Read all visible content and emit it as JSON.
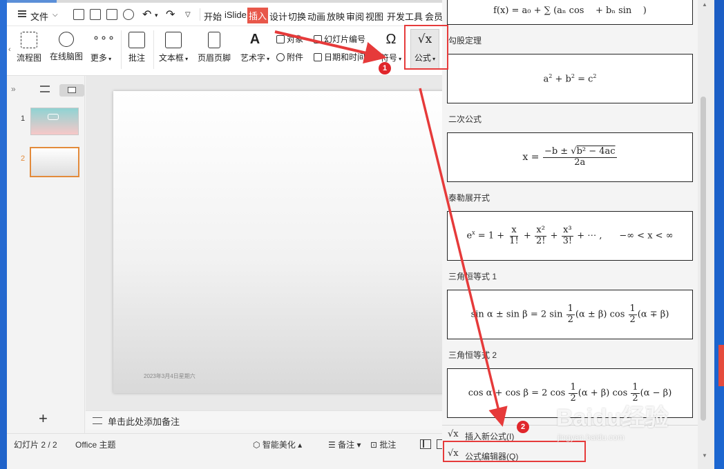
{
  "menu": {
    "file": "文件",
    "tabs": [
      "开始",
      "iSlide",
      "插入",
      "设计",
      "切换",
      "动画",
      "放映",
      "审阅",
      "视图",
      "开发工具",
      "会员"
    ],
    "active_tab": "插入"
  },
  "ribbon": {
    "flowchart": "流程图",
    "mindmap": "在线脑图",
    "more": "更多",
    "comment": "批注",
    "textbox": "文本框",
    "header_footer": "页眉页脚",
    "wordart": "艺术字",
    "object": "对象",
    "attachment": "附件",
    "slide_number": "幻灯片编号",
    "datetime": "日期和时间",
    "symbol": "符号",
    "formula": "公式"
  },
  "thumbs": [
    {
      "num": "1"
    },
    {
      "num": "2"
    }
  ],
  "slide": {
    "date": "2023年3月4日星期六"
  },
  "notes_placeholder": "单击此处添加备注",
  "status": {
    "slide_info": "幻灯片 2 / 2",
    "theme": "Office 主题",
    "beautify": "智能美化",
    "notes": "备注",
    "comment": "批注"
  },
  "formula_panel": {
    "sections": [
      {
        "label": "勾股定理",
        "formula": "a² + b² = c²"
      },
      {
        "label": "二次公式",
        "formula": "x = (−b ± √(b² − 4ac)) / 2a"
      },
      {
        "label": "泰勒展开式",
        "formula": "eˣ = 1 + x/1! + x²/2! + x³/3! + ⋯ ,  −∞ < x < ∞"
      },
      {
        "label": "三角恒等式 1",
        "formula": "sin α ± sin β = 2 sin ½(α ± β) cos ½(α ∓ β)"
      },
      {
        "label": "三角恒等式 2",
        "formula": "cos α + cos β = 2 cos ½(α + β) cos ½(α − β)"
      }
    ],
    "insert_new": "插入新公式(I)",
    "editor": "公式编辑器(Q)"
  },
  "annotations": {
    "badge1": "1",
    "badge2": "2"
  },
  "watermark": {
    "brand": "Baidu经验",
    "url": "jingyan.baidu.com"
  },
  "colors": {
    "accent": "#e63a3a",
    "active_tab_bg": "#e8574a",
    "thumb_selected": "#e38a3a"
  }
}
